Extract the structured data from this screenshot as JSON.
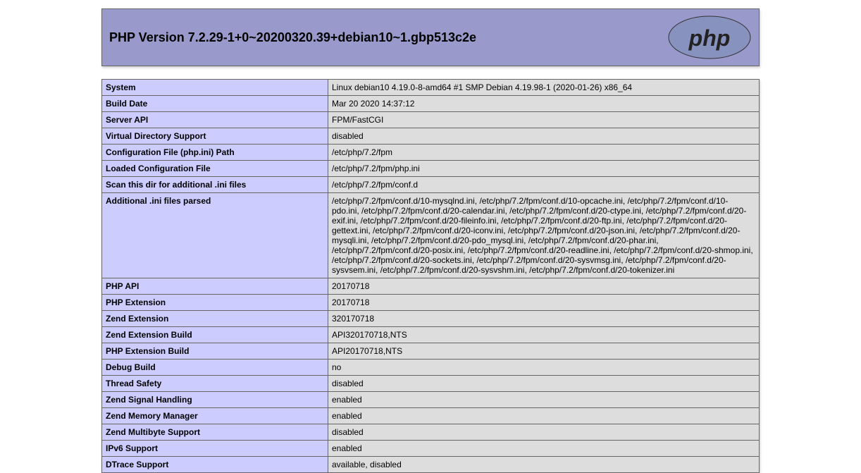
{
  "header": {
    "title": "PHP Version 7.2.29-1+0~20200320.39+debian10~1.gbp513c2e"
  },
  "rows": [
    {
      "label": "System",
      "value": "Linux debian10 4.19.0-8-amd64 #1 SMP Debian 4.19.98-1 (2020-01-26) x86_64"
    },
    {
      "label": "Build Date",
      "value": "Mar 20 2020 14:37:12"
    },
    {
      "label": "Server API",
      "value": "FPM/FastCGI"
    },
    {
      "label": "Virtual Directory Support",
      "value": "disabled"
    },
    {
      "label": "Configuration File (php.ini) Path",
      "value": "/etc/php/7.2/fpm"
    },
    {
      "label": "Loaded Configuration File",
      "value": "/etc/php/7.2/fpm/php.ini"
    },
    {
      "label": "Scan this dir for additional .ini files",
      "value": "/etc/php/7.2/fpm/conf.d"
    },
    {
      "label": "Additional .ini files parsed",
      "value": "/etc/php/7.2/fpm/conf.d/10-mysqlnd.ini, /etc/php/7.2/fpm/conf.d/10-opcache.ini, /etc/php/7.2/fpm/conf.d/10-pdo.ini, /etc/php/7.2/fpm/conf.d/20-calendar.ini, /etc/php/7.2/fpm/conf.d/20-ctype.ini, /etc/php/7.2/fpm/conf.d/20-exif.ini, /etc/php/7.2/fpm/conf.d/20-fileinfo.ini, /etc/php/7.2/fpm/conf.d/20-ftp.ini, /etc/php/7.2/fpm/conf.d/20-gettext.ini, /etc/php/7.2/fpm/conf.d/20-iconv.ini, /etc/php/7.2/fpm/conf.d/20-json.ini, /etc/php/7.2/fpm/conf.d/20-mysqli.ini, /etc/php/7.2/fpm/conf.d/20-pdo_mysql.ini, /etc/php/7.2/fpm/conf.d/20-phar.ini, /etc/php/7.2/fpm/conf.d/20-posix.ini, /etc/php/7.2/fpm/conf.d/20-readline.ini, /etc/php/7.2/fpm/conf.d/20-shmop.ini, /etc/php/7.2/fpm/conf.d/20-sockets.ini, /etc/php/7.2/fpm/conf.d/20-sysvmsg.ini, /etc/php/7.2/fpm/conf.d/20-sysvsem.ini, /etc/php/7.2/fpm/conf.d/20-sysvshm.ini, /etc/php/7.2/fpm/conf.d/20-tokenizer.ini"
    },
    {
      "label": "PHP API",
      "value": "20170718"
    },
    {
      "label": "PHP Extension",
      "value": "20170718"
    },
    {
      "label": "Zend Extension",
      "value": "320170718"
    },
    {
      "label": "Zend Extension Build",
      "value": "API320170718,NTS"
    },
    {
      "label": "PHP Extension Build",
      "value": "API20170718,NTS"
    },
    {
      "label": "Debug Build",
      "value": "no"
    },
    {
      "label": "Thread Safety",
      "value": "disabled"
    },
    {
      "label": "Zend Signal Handling",
      "value": "enabled"
    },
    {
      "label": "Zend Memory Manager",
      "value": "enabled"
    },
    {
      "label": "Zend Multibyte Support",
      "value": "disabled"
    },
    {
      "label": "IPv6 Support",
      "value": "enabled"
    },
    {
      "label": "DTrace Support",
      "value": "available, disabled"
    }
  ]
}
